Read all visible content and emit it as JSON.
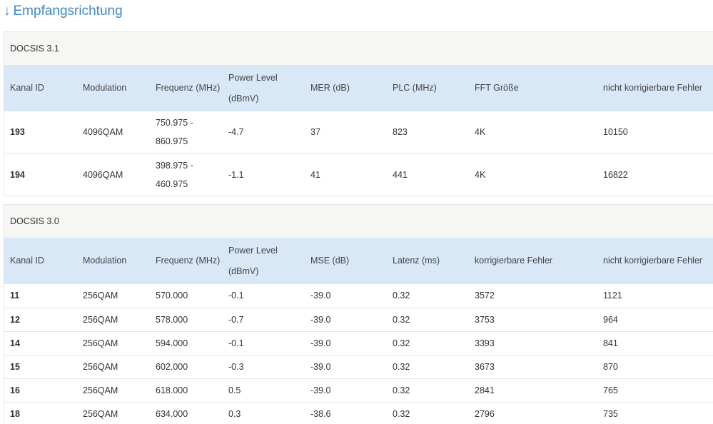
{
  "heading": {
    "arrow": "↓",
    "title": "Empfangsrichtung"
  },
  "docsis31": {
    "caption": "DOCSIS 3.1",
    "headers": [
      "Kanal ID",
      "Modulation",
      "Frequenz (MHz)",
      "Power Level (dBmV)",
      "MER (dB)",
      "PLC (MHz)",
      "FFT Größe",
      "nicht korrigierbare Fehler"
    ],
    "rows": [
      [
        "193",
        "4096QAM",
        "750.975 - 860.975",
        "-4.7",
        "37",
        "823",
        "4K",
        "10150"
      ],
      [
        "194",
        "4096QAM",
        "398.975 - 460.975",
        "-1.1",
        "41",
        "441",
        "4K",
        "16822"
      ]
    ]
  },
  "docsis30": {
    "caption": "DOCSIS 3.0",
    "headers": [
      "Kanal ID",
      "Modulation",
      "Frequenz (MHz)",
      "Power Level (dBmV)",
      "MSE (dB)",
      "Latenz (ms)",
      "korrigierbare Fehler",
      "nicht korrigierbare Fehler"
    ],
    "rows": [
      [
        "11",
        "256QAM",
        "570.000",
        "-0.1",
        "-39.0",
        "0.32",
        "3572",
        "1121"
      ],
      [
        "12",
        "256QAM",
        "578.000",
        "-0.7",
        "-39.0",
        "0.32",
        "3753",
        "964"
      ],
      [
        "14",
        "256QAM",
        "594.000",
        "-0.1",
        "-39.0",
        "0.32",
        "3393",
        "841"
      ],
      [
        "15",
        "256QAM",
        "602.000",
        "-0.3",
        "-39.0",
        "0.32",
        "3673",
        "870"
      ],
      [
        "16",
        "256QAM",
        "618.000",
        "0.5",
        "-39.0",
        "0.32",
        "2841",
        "765"
      ],
      [
        "18",
        "256QAM",
        "634.000",
        "0.3",
        "-38.6",
        "0.32",
        "2796",
        "735"
      ]
    ]
  },
  "colors": {
    "heading": "#3f87c4",
    "header_row": "#d8e8f7",
    "caption_bg": "#f6f6f4"
  }
}
